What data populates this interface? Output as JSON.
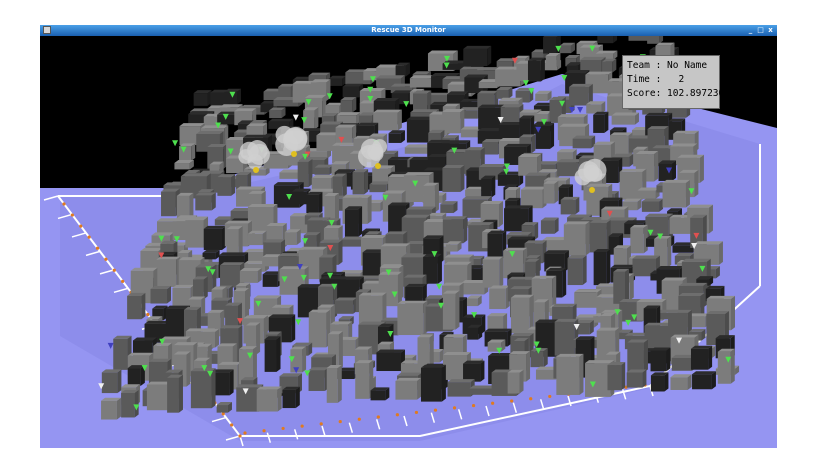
{
  "window": {
    "title": "Rescue 3D Monitor",
    "controls": [
      "_",
      "□",
      "x"
    ]
  },
  "hud": {
    "team_label": "Team : ",
    "team_value": "No Name",
    "time_label": "Time : ",
    "time_value": "2",
    "score_label": "Score: ",
    "score_value": "102.897230"
  },
  "colors": {
    "background": "#000000",
    "ground": "#9090f0",
    "road": "#ffffff",
    "titlebar": "#2f7fd0",
    "hud": "#c6c6c6",
    "agent_green": "#4ee04e",
    "agent_red": "#e05050",
    "agent_white": "#f0f0f0",
    "civilian_blue": "#4040c0",
    "smoke": "#cfcfcf"
  }
}
